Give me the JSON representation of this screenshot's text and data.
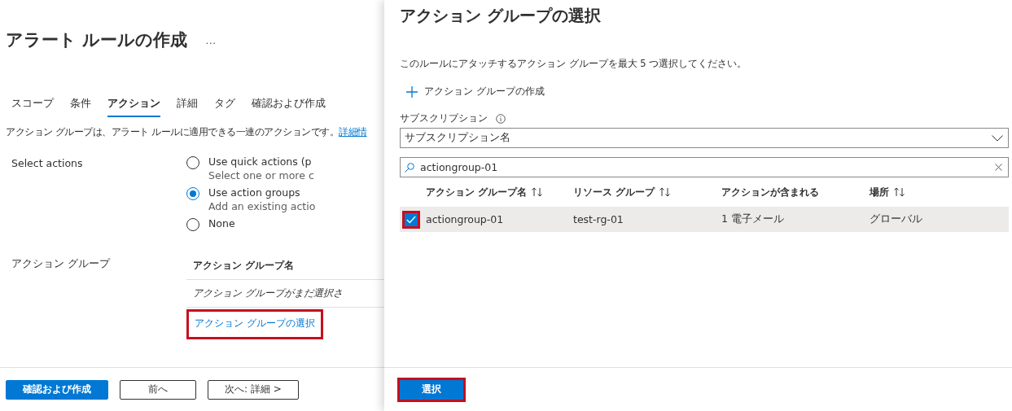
{
  "page": {
    "title": "アラート ルールの作成",
    "more": "…",
    "tabs": [
      {
        "label": "スコープ",
        "selected": false
      },
      {
        "label": "条件",
        "selected": false
      },
      {
        "label": "アクション",
        "selected": true
      },
      {
        "label": "詳細",
        "selected": false
      },
      {
        "label": "タグ",
        "selected": false
      },
      {
        "label": "確認および作成",
        "selected": false
      }
    ],
    "description": "アクション グループは、アラート ルールに適用できる一連のアクションです。",
    "description_link": "詳細情",
    "select_actions": {
      "label": "Select actions",
      "options": [
        {
          "label": "Use quick actions (p",
          "hint": "Select one or more c",
          "selected": false
        },
        {
          "label": "Use action groups",
          "hint": "Add an existing actio",
          "selected": true
        },
        {
          "label": "None",
          "selected": false
        }
      ]
    },
    "action_group": {
      "label": "アクション グループ",
      "column": "アクション グループ名",
      "empty": "アクション グループがまだ選択さ",
      "link": "アクション グループの選択",
      "highlighted": true
    },
    "footer": [
      {
        "label": "確認および作成",
        "kind": "primary"
      },
      {
        "label": "前へ",
        "kind": "secondary"
      },
      {
        "label": "次へ: 詳細 >",
        "kind": "secondary"
      }
    ]
  },
  "blade": {
    "title": "アクション グループの選択",
    "description": "このルールにアタッチするアクション グループを最大 5 つ選択してください。",
    "create": "アクション グループの作成",
    "subscription": {
      "label": "サブスクリプション",
      "value": "サブスクリプション名"
    },
    "search": {
      "value": "actiongroup-01"
    },
    "columns": [
      {
        "label": "アクション グループ名",
        "sortable": true
      },
      {
        "label": "リソース グループ",
        "sortable": true
      },
      {
        "label": "アクションが含まれる",
        "sortable": false
      },
      {
        "label": "場所",
        "sortable": true
      }
    ],
    "rows": [
      {
        "checked": true,
        "highlighted": true,
        "cells": [
          "actiongroup-01",
          "test-rg-01",
          "1 電子メール",
          "グローバル"
        ]
      }
    ],
    "submit": {
      "label": "選択",
      "highlighted": true
    }
  }
}
